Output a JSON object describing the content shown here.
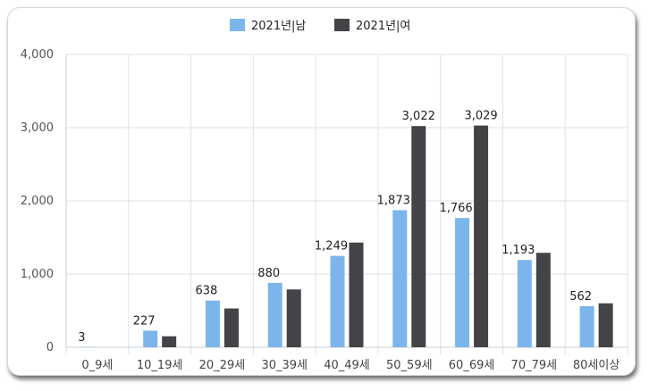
{
  "chart_data": {
    "type": "bar",
    "categories": [
      "0_9세",
      "10_19세",
      "20_29세",
      "30_39세",
      "40_49세",
      "50_59세",
      "60_69세",
      "70_79세",
      "80세이상"
    ],
    "series": [
      {
        "name": "2021년|남",
        "color": "#7cb5ec",
        "values": [
          3,
          227,
          638,
          880,
          1249,
          1873,
          1766,
          1193,
          562
        ],
        "labels": [
          "3",
          "227",
          "638",
          "880",
          "1,249",
          "1,873",
          "1,766",
          "1,193",
          "562"
        ]
      },
      {
        "name": "2021년|여",
        "color": "#434348",
        "values": [
          0,
          150,
          530,
          790,
          1430,
          3022,
          3029,
          1290,
          600
        ],
        "labels": [
          "",
          "",
          "",
          "",
          "",
          "3,022",
          "3,029",
          "",
          ""
        ]
      }
    ],
    "ylim": [
      0,
      4000
    ],
    "yticks": [
      0,
      1000,
      2000,
      3000,
      4000
    ],
    "ytick_labels": [
      "0",
      "1,000",
      "2,000",
      "3,000",
      "4,000"
    ],
    "legend_position": "top-center",
    "grid": true
  }
}
